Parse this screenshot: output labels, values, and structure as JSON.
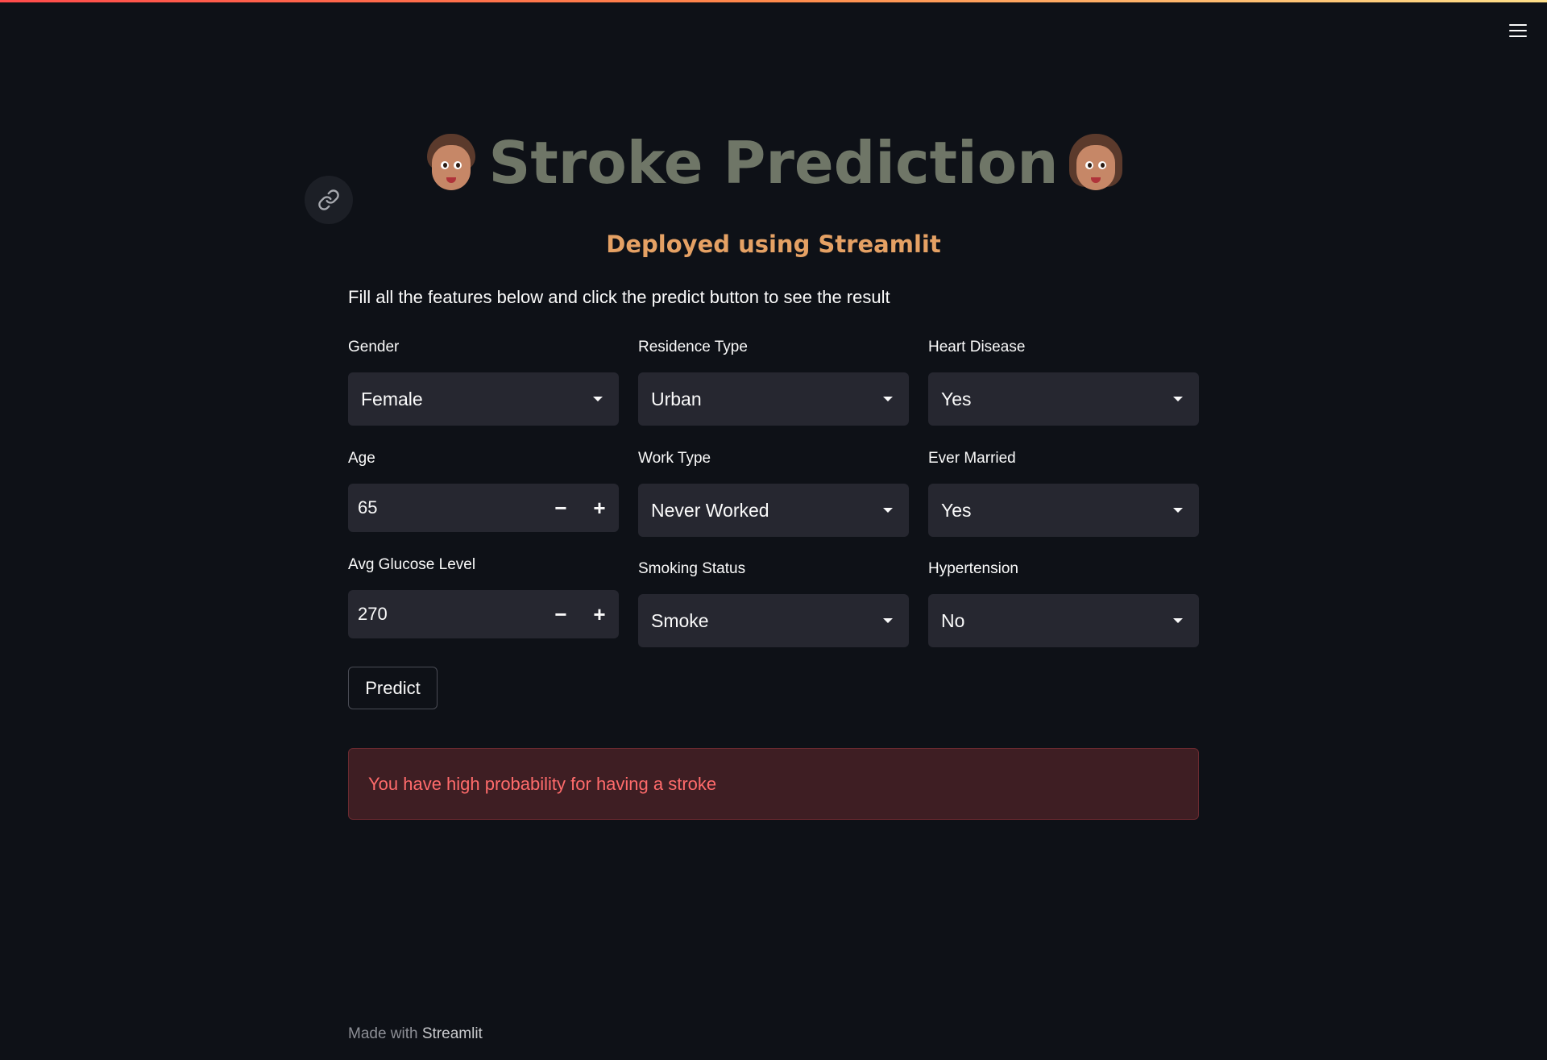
{
  "header": {
    "menu_icon": "hamburger-menu-icon"
  },
  "title": {
    "text": "Stroke Prediction",
    "left_emoji": "man-face-emoji",
    "right_emoji": "woman-face-emoji"
  },
  "subtitle": "Deployed using Streamlit",
  "instructions": "Fill all the features below and click the predict button to see the result",
  "fields": {
    "gender": {
      "label": "Gender",
      "value": "Female"
    },
    "residence_type": {
      "label": "Residence Type",
      "value": "Urban"
    },
    "heart_disease": {
      "label": "Heart Disease",
      "value": "Yes"
    },
    "age": {
      "label": "Age",
      "value": "65"
    },
    "work_type": {
      "label": "Work Type",
      "value": "Never Worked"
    },
    "ever_married": {
      "label": "Ever Married",
      "value": "Yes"
    },
    "avg_glucose_level": {
      "label": "Avg Glucose Level",
      "value": "270"
    },
    "smoking_status": {
      "label": "Smoking Status",
      "value": "Smoke"
    },
    "hypertension": {
      "label": "Hypertension",
      "value": "No"
    }
  },
  "stepper": {
    "minus": "−",
    "plus": "+"
  },
  "predict_label": "Predict",
  "result_message": "You have high probability for having a stroke",
  "footer": {
    "prefix": "Made with ",
    "brand": "Streamlit"
  },
  "colors": {
    "background": "#0e1117",
    "title": "#6f7667",
    "subtitle": "#e5a164",
    "input_bg": "#262730",
    "error_bg": "#3e1e23",
    "error_text": "#ff6b6b"
  }
}
